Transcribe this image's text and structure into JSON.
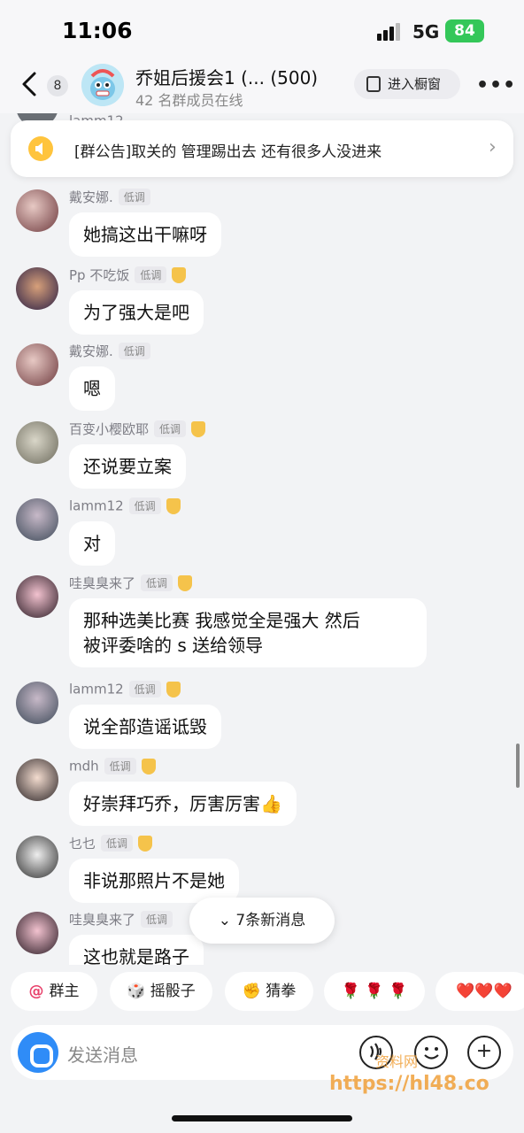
{
  "status": {
    "time": "11:06",
    "network": "5G",
    "battery": "84"
  },
  "header": {
    "back_count": "8",
    "title": "乔姐后援会1 (...  (500)",
    "subtitle": "42 名群成员在线",
    "shop_label": "进入橱窗"
  },
  "notice": {
    "text": "[群公告]取关的 管理踢出去 还有很多人没进来"
  },
  "messages": [
    {
      "name": "戴安娜.",
      "tag": "低调",
      "text": "她搞这出干嘛呀"
    },
    {
      "name": "Pp 不吃饭",
      "tag": "低调",
      "text": "为了强大是吧"
    },
    {
      "name": "戴安娜.",
      "tag": "低调",
      "text": "嗯"
    },
    {
      "name": "百变小樱欧耶",
      "tag": "低调",
      "text": "还说要立案"
    },
    {
      "name": "lamm12",
      "tag": "低调",
      "text": "对"
    },
    {
      "name": "哇臭臭来了",
      "tag": "低调",
      "text": "那种选美比赛 我感觉全是强大 然后",
      "text2": "被评委啥的 s 送给领导"
    },
    {
      "name": "lamm12",
      "tag": "低调",
      "text": "说全部造谣诋毁"
    },
    {
      "name": "mdh",
      "tag": "低调",
      "text": "好崇拜巧乔，厉害厉害👍"
    },
    {
      "name": "乜乜",
      "tag": "低调",
      "text": "非说那照片不是她"
    },
    {
      "name": "哇臭臭来了",
      "tag": "低调",
      "text": "这也就是路子"
    }
  ],
  "top_partial_name": "lamm12",
  "new_messages": "7条新消息",
  "quick_actions": [
    "群主",
    "摇骰子",
    "猜拳",
    "🌹 🌹 🌹",
    "❤️❤️❤️"
  ],
  "input": {
    "placeholder": "发送消息"
  },
  "watermark": {
    "line1": "资料网",
    "line2": "https://hl48.co"
  },
  "colors": {
    "accent_blue": "#2f8cf7",
    "battery_green": "#34c759",
    "notice_yellow": "#ffc43d"
  },
  "icons": [
    "back-chevron-icon",
    "shop-bag-icon",
    "more-dots-icon",
    "speaker-icon",
    "chevron-right-icon",
    "voice-icon",
    "audio-wave-icon",
    "emoji-icon",
    "plus-icon"
  ]
}
